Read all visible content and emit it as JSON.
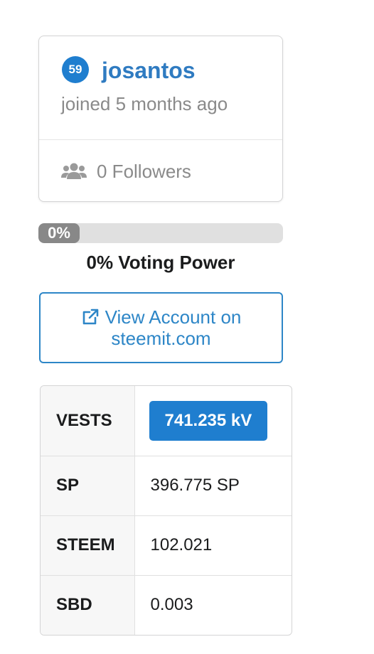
{
  "profile": {
    "reputation": "59",
    "username": "josantos",
    "joined": "joined 5 months ago",
    "followers": "0 Followers",
    "followers_icon": "users-icon"
  },
  "voting_power": {
    "percent_label": "0%",
    "value_fraction": 0,
    "label": "0% Voting Power"
  },
  "view_account": {
    "icon": "external-link-icon",
    "line1": "View Account on",
    "line2": "steemit.com"
  },
  "stats": {
    "rows": [
      {
        "key": "VESTS",
        "value": "741.235 kV"
      },
      {
        "key": "SP",
        "value": "396.775 SP"
      },
      {
        "key": "STEEM",
        "value": "102.021"
      },
      {
        "key": "SBD",
        "value": "0.003"
      }
    ]
  },
  "colors": {
    "accent": "#1f7ecf",
    "username": "#2f7bc1",
    "muted_text": "#8a8a8a",
    "progress_track": "#e0e0e0",
    "progress_fill": "#888888"
  }
}
